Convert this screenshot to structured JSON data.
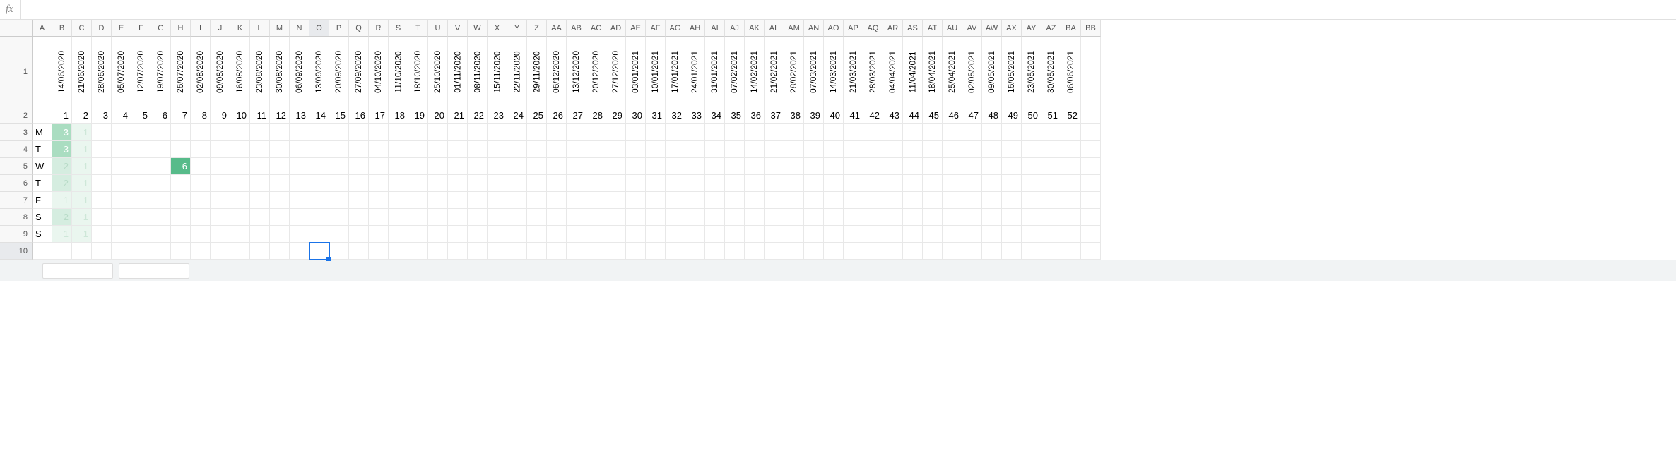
{
  "formula_bar": {
    "fx_label": "fx",
    "value": ""
  },
  "columns": [
    "A",
    "B",
    "C",
    "D",
    "E",
    "F",
    "G",
    "H",
    "I",
    "J",
    "K",
    "L",
    "M",
    "N",
    "O",
    "P",
    "Q",
    "R",
    "S",
    "T",
    "U",
    "V",
    "W",
    "X",
    "Y",
    "Z",
    "AA",
    "AB",
    "AC",
    "AD",
    "AE",
    "AF",
    "AG",
    "AH",
    "AI",
    "AJ",
    "AK",
    "AL",
    "AM",
    "AN",
    "AO",
    "AP",
    "AQ",
    "AR",
    "AS",
    "AT",
    "AU",
    "AV",
    "AW",
    "AX",
    "AY",
    "AZ",
    "BA",
    "BB"
  ],
  "rows": [
    "1",
    "2",
    "3",
    "4",
    "5",
    "6",
    "7",
    "8",
    "9",
    "10"
  ],
  "selected_col": "O",
  "selected_row": "10",
  "row1_dates": [
    "14/06/2020",
    "21/06/2020",
    "28/06/2020",
    "05/07/2020",
    "12/07/2020",
    "19/07/2020",
    "26/07/2020",
    "02/08/2020",
    "09/08/2020",
    "16/08/2020",
    "23/08/2020",
    "30/08/2020",
    "06/09/2020",
    "13/09/2020",
    "20/09/2020",
    "27/09/2020",
    "04/10/2020",
    "11/10/2020",
    "18/10/2020",
    "25/10/2020",
    "01/11/2020",
    "08/11/2020",
    "15/11/2020",
    "22/11/2020",
    "29/11/2020",
    "06/12/2020",
    "13/12/2020",
    "20/12/2020",
    "27/12/2020",
    "03/01/2021",
    "10/01/2021",
    "17/01/2021",
    "24/01/2021",
    "31/01/2021",
    "07/02/2021",
    "14/02/2021",
    "21/02/2021",
    "28/02/2021",
    "07/03/2021",
    "14/03/2021",
    "21/03/2021",
    "28/03/2021",
    "04/04/2021",
    "11/04/2021",
    "18/04/2021",
    "25/04/2021",
    "02/05/2021",
    "09/05/2021",
    "16/05/2021",
    "23/05/2021",
    "30/05/2021",
    "06/06/2021"
  ],
  "row2_numbers": [
    "1",
    "2",
    "3",
    "4",
    "5",
    "6",
    "7",
    "8",
    "9",
    "10",
    "11",
    "12",
    "13",
    "14",
    "15",
    "16",
    "17",
    "18",
    "19",
    "20",
    "21",
    "22",
    "23",
    "24",
    "25",
    "26",
    "27",
    "28",
    "29",
    "30",
    "31",
    "32",
    "33",
    "34",
    "35",
    "36",
    "37",
    "38",
    "39",
    "40",
    "41",
    "42",
    "43",
    "44",
    "45",
    "46",
    "47",
    "48",
    "49",
    "50",
    "51",
    "52"
  ],
  "day_labels": [
    "M",
    "T",
    "W",
    "T",
    "F",
    "S",
    "S"
  ],
  "heat_rows": [
    [
      {
        "v": "3",
        "cls": "g2"
      },
      {
        "v": "1",
        "cls": "g0"
      }
    ],
    [
      {
        "v": "3",
        "cls": "g2"
      },
      {
        "v": "1",
        "cls": "g0"
      }
    ],
    [
      {
        "v": "2",
        "cls": "g1"
      },
      {
        "v": "1",
        "cls": "g0"
      },
      {
        "v": "",
        "cls": ""
      },
      {
        "v": "",
        "cls": ""
      },
      {
        "v": "",
        "cls": ""
      },
      {
        "v": "",
        "cls": ""
      },
      {
        "v": "6",
        "cls": "g3"
      }
    ],
    [
      {
        "v": "2",
        "cls": "g1"
      },
      {
        "v": "1",
        "cls": "g0"
      }
    ],
    [
      {
        "v": "1",
        "cls": "g0"
      },
      {
        "v": "1",
        "cls": "g0"
      }
    ],
    [
      {
        "v": "2",
        "cls": "g1"
      },
      {
        "v": "1",
        "cls": "g0"
      }
    ],
    [
      {
        "v": "1",
        "cls": "g0"
      },
      {
        "v": "1",
        "cls": "g0"
      }
    ]
  ],
  "chart_data": {
    "type": "heatmap",
    "title": "",
    "x_categories_dates": [
      "14/06/2020",
      "21/06/2020",
      "28/06/2020",
      "05/07/2020",
      "12/07/2020",
      "19/07/2020",
      "26/07/2020",
      "02/08/2020",
      "09/08/2020",
      "16/08/2020",
      "23/08/2020",
      "30/08/2020",
      "06/09/2020",
      "13/09/2020",
      "20/09/2020",
      "27/09/2020",
      "04/10/2020",
      "11/10/2020",
      "18/10/2020",
      "25/10/2020",
      "01/11/2020",
      "08/11/2020",
      "15/11/2020",
      "22/11/2020",
      "29/11/2020",
      "06/12/2020",
      "13/12/2020",
      "20/12/2020",
      "27/12/2020",
      "03/01/2021",
      "10/01/2021",
      "17/01/2021",
      "24/01/2021",
      "31/01/2021",
      "07/02/2021",
      "14/02/2021",
      "21/02/2021",
      "28/02/2021",
      "07/03/2021",
      "14/03/2021",
      "21/03/2021",
      "28/03/2021",
      "04/04/2021",
      "11/04/2021",
      "18/04/2021",
      "25/04/2021",
      "02/05/2021",
      "09/05/2021",
      "16/05/2021",
      "23/05/2021",
      "30/05/2021",
      "06/06/2021"
    ],
    "x_categories_week": [
      1,
      2,
      3,
      4,
      5,
      6,
      7,
      8,
      9,
      10,
      11,
      12,
      13,
      14,
      15,
      16,
      17,
      18,
      19,
      20,
      21,
      22,
      23,
      24,
      25,
      26,
      27,
      28,
      29,
      30,
      31,
      32,
      33,
      34,
      35,
      36,
      37,
      38,
      39,
      40,
      41,
      42,
      43,
      44,
      45,
      46,
      47,
      48,
      49,
      50,
      51,
      52
    ],
    "y_categories": [
      "M",
      "T",
      "W",
      "T",
      "F",
      "S",
      "S"
    ],
    "values": [
      [
        3,
        1
      ],
      [
        3,
        1
      ],
      [
        2,
        1,
        null,
        null,
        null,
        null,
        6
      ],
      [
        2,
        1
      ],
      [
        1,
        1
      ],
      [
        2,
        1
      ],
      [
        1,
        1
      ]
    ],
    "color_scale": {
      "low": "#eaf6ef",
      "high": "#57bb8a"
    }
  }
}
